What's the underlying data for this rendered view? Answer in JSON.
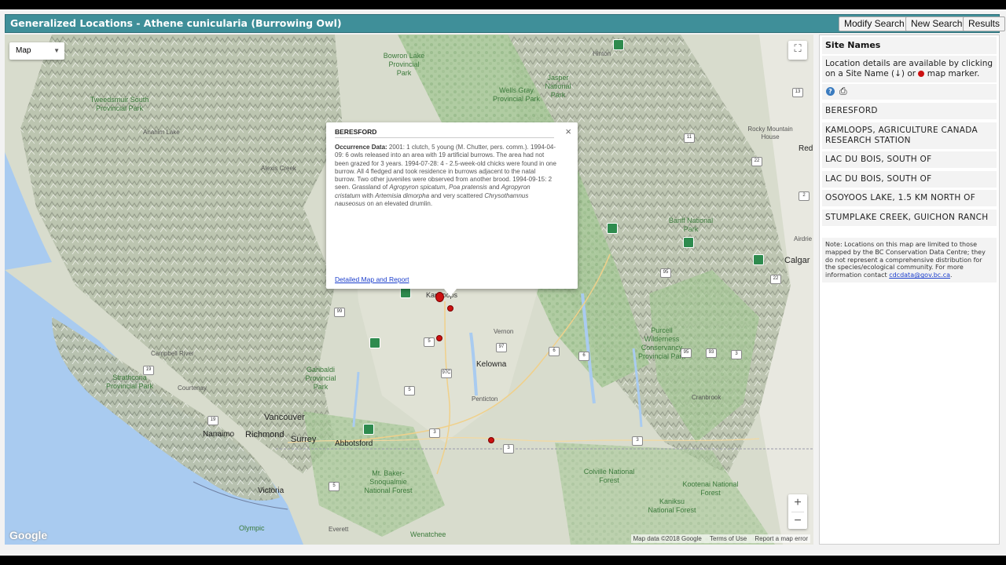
{
  "header": {
    "title": "Generalized Locations - Athene cunicularia (Burrowing Owl)",
    "buttons": [
      "Modify Search",
      "New Search",
      "Results"
    ]
  },
  "map": {
    "map_type": "Map",
    "attribution": {
      "data": "Map data ©2018 Google",
      "terms": "Terms of Use",
      "report": "Report a map error"
    },
    "logo": "Google",
    "labels": {
      "vancouver": "Vancouver",
      "richmond": "Richmond",
      "surrey": "Surrey",
      "abbotsford": "Abbotsford",
      "nanaimo": "Nanaimo",
      "victoria": "Victoria",
      "kelowna": "Kelowna",
      "penticton": "Penticton",
      "vernon": "Vernon",
      "kamloops": "Kamloops",
      "calgary": "Calgar",
      "red": "Red",
      "courtenay": "Courtenay",
      "campbell": "Campbell River",
      "everett": "Everett",
      "alexis": "Alexis Creek",
      "anahim": "Anahim Lake",
      "hinton": "Hinton",
      "rocky": "Rocky Mountain House",
      "airdrie": "Airdrie",
      "cranbrook": "Cranbrook",
      "park_tweedsmuir": "Tweedsmuir South Provincial Park",
      "park_wells": "Wells Gray Provincial Park",
      "park_banff": "Banff National Park",
      "park_purcell": "Purcell Wilderness Conservancy Provincial Park",
      "park_colville": "Colville National Forest",
      "park_kootenai": "Kootenai National Forest",
      "park_kaniksu": "Kaniksu National Forest",
      "park_mtbaker": "Mt. Baker-Snoqualmie National Forest",
      "park_garibaldi": "Garibaldi Provincial Park",
      "park_strathcona": "Strathcona Provincial Park",
      "park_bowron": "Bowron Lake Provincial Park",
      "park_jasper": "Jasper National Park",
      "park_olympic": "Olympic",
      "park_wenatchee": "Wenatchee"
    }
  },
  "popup": {
    "title": "BERESFORD",
    "body_label": "Occurrence Data:",
    "body_text": " 2001: 1 clutch, 5 young (M. Chutter, pers. comm.). 1994-04-09: 6 owls released into an area with 19 artificial burrows. The area had not been grazed for 3 years. 1994-07-28: 4 - 2.5-week-old chicks were found in one burrow. All 4 fledged and took residence in burrows adjacent to the natal burrow. Two other juveniles were observed from another brood. 1994-09-15: 2 seen. Grassland of ",
    "sp1": "Agropyron spicatum",
    "t1": ", ",
    "sp2": "Poa pratensis",
    "t2": " and ",
    "sp3": "Agropyron cristatum",
    "t3": " with ",
    "sp4": "Artemisia dimorpha",
    "t4": " and very scattered ",
    "sp5": "Chrysothamnus nauseosus",
    "t5": " on an elevated drumlin.",
    "close": "×",
    "link": "Detailed Map and Report"
  },
  "sidebar": {
    "heading": "Site Names",
    "desc_a": "Location details are available by clicking on a Site Name (",
    "desc_arrow": "↓",
    "desc_b": ") or ",
    "desc_c": " map marker.",
    "sites": [
      "BERESFORD",
      "KAMLOOPS, AGRICULTURE CANADA RESEARCH STATION",
      "LAC DU BOIS, SOUTH OF",
      "LAC DU BOIS, SOUTH OF",
      "OSOYOOS LAKE, 1.5 KM NORTH OF",
      "STUMPLAKE CREEK, GUICHON RANCH"
    ],
    "note_text": "Note: Locations on this map are limited to those mapped by the BC Conservation Data Centre; they do not represent a comprehensive distribution for the species/ecological community. For more information contact ",
    "note_email": "cdcdata@gov.bc.ca",
    "note_end": ".",
    "help": "?"
  },
  "colors": {
    "header": "#3f8f99",
    "marker": "#cc1111",
    "link": "#1a3dcc"
  }
}
